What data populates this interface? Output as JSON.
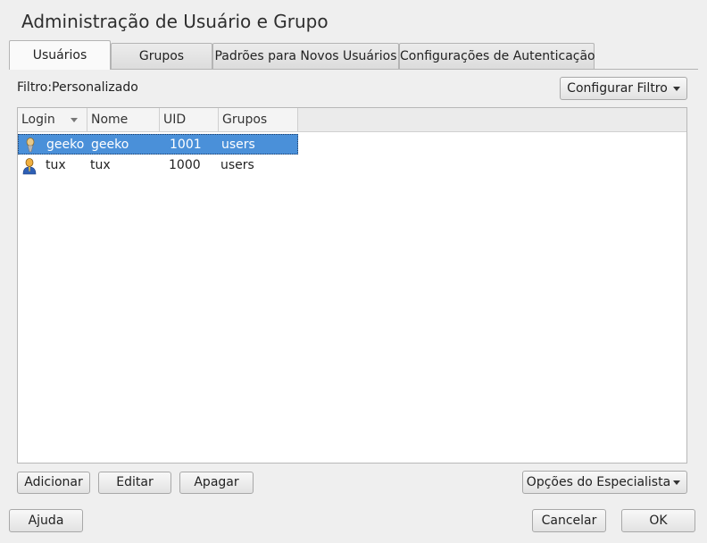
{
  "window": {
    "title": "Administração de Usuário e Grupo"
  },
  "tabs": [
    {
      "label": "Usuários",
      "active": true
    },
    {
      "label": "Grupos",
      "active": false
    },
    {
      "label": "Padrões para Novos Usuários",
      "active": false
    },
    {
      "label": "Configurações de Autenticação",
      "active": false
    }
  ],
  "filter": {
    "label": "Filtro:Personalizado",
    "button_label": "Configurar Filtro"
  },
  "table": {
    "columns": [
      "Login",
      "Nome",
      "UID",
      "Grupos"
    ],
    "rows": [
      {
        "login": "geeko",
        "name": "geeko",
        "uid": "1001",
        "groups": "users",
        "selected": true,
        "icon": "user-icon-light"
      },
      {
        "login": "tux",
        "name": "tux",
        "uid": "1000",
        "groups": "users",
        "selected": false,
        "icon": "user-icon-blue"
      }
    ]
  },
  "actions": {
    "add": "Adicionar",
    "edit": "Editar",
    "delete": "Apagar",
    "expert": "Opções do Especialista"
  },
  "footer": {
    "help": "Ajuda",
    "cancel": "Cancelar",
    "ok": "OK"
  },
  "colors": {
    "selection": "#4a90d9",
    "background": "#efefef"
  }
}
